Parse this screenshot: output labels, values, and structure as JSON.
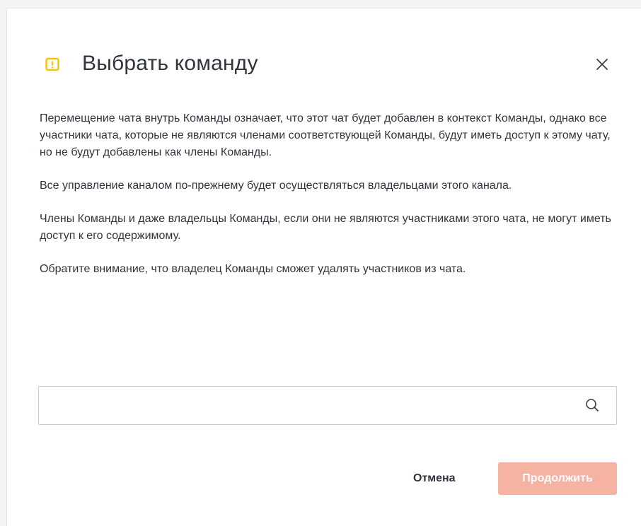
{
  "dialog": {
    "title": "Выбрать команду",
    "paragraphs": [
      "Перемещение чата внутрь Команды означает, что этот чат будет добавлен в контекст Команды, однако все участники чата, которые не являются членами соответствующей Команды, будут иметь доступ к этому чату, но не будут добавлены как члены Команды.",
      "Все управление каналом по-прежнему будет осуществляться владельцами этого канала.",
      "Члены Команды и даже владельцы Команды, если они не являются участниками этого чата, не могут иметь доступ к его содержимому.",
      "Обратите внимание, что владелец Команды сможет удалять участников из чата."
    ],
    "search": {
      "value": "",
      "placeholder": ""
    },
    "buttons": {
      "cancel": "Отмена",
      "continue": "Продолжить"
    }
  },
  "icons": {
    "warning": "warning-icon",
    "close": "close-icon",
    "search": "search-icon"
  },
  "colors": {
    "warning": "#f5c400",
    "text": "#2f343d",
    "primary_disabled": "#f6b3a4",
    "border": "#cbced1"
  }
}
